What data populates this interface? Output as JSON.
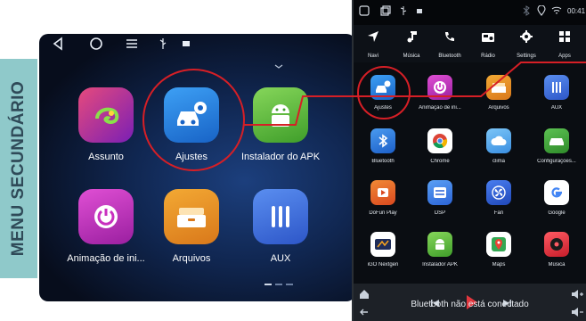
{
  "banner": {
    "text": "MENU SECUNDÁRIO"
  },
  "left_screen": {
    "status_icons": [
      "back-icon",
      "home-icon",
      "menu-icon",
      "usb-icon",
      "image-icon"
    ],
    "apps": [
      {
        "label": "Assunto",
        "icon": "chameleon-icon",
        "color": "#d0346e"
      },
      {
        "label": "Ajustes",
        "icon": "car-gear-icon",
        "color": "#2a8ae6"
      },
      {
        "label": "Instalador do APK",
        "icon": "android-icon",
        "color": "#66c23a"
      },
      {
        "label": "Animação de ini...",
        "icon": "power-icon",
        "color": "#c92fbf"
      },
      {
        "label": "Arquivos",
        "icon": "drawer-icon",
        "color": "#e7951f"
      },
      {
        "label": "AUX",
        "icon": "aux-icon",
        "color": "#3a73e8"
      }
    ]
  },
  "right_screen": {
    "clock": "00:41",
    "nav": [
      {
        "label": "Navi",
        "icon": "navigation-icon"
      },
      {
        "label": "Música",
        "icon": "music-icon"
      },
      {
        "label": "Bluetooth",
        "icon": "phone-icon"
      },
      {
        "label": "Rádio",
        "icon": "radio-icon"
      },
      {
        "label": "Settings",
        "icon": "gear-icon"
      },
      {
        "label": "Apps",
        "icon": "apps-icon"
      }
    ],
    "apps": [
      {
        "label": "Ajustes",
        "icon": "car-gear-icon",
        "color": "#2a8ae6"
      },
      {
        "label": "Animação de ini...",
        "icon": "power-icon",
        "color": "#c92fbf"
      },
      {
        "label": "Arquivos",
        "icon": "drawer-icon",
        "color": "#e7951f"
      },
      {
        "label": "AUX",
        "icon": "aux-icon",
        "color": "#3a73e8"
      },
      {
        "label": "Bluetooth",
        "icon": "bluetooth-icon",
        "color": "#2f7fe0"
      },
      {
        "label": "Chrome",
        "icon": "chrome-icon",
        "color": "#ffffff"
      },
      {
        "label": "clima",
        "icon": "cloud-icon",
        "color": "#4aa6f0"
      },
      {
        "label": "Configurações...",
        "icon": "car-settings-icon",
        "color": "#49a842"
      },
      {
        "label": "DoFun Play",
        "icon": "dofun-icon",
        "color": "#e6602a"
      },
      {
        "label": "DSP",
        "icon": "dsp-icon",
        "color": "#3a79e6"
      },
      {
        "label": "Fan",
        "icon": "fan-icon",
        "color": "#2b64d9"
      },
      {
        "label": "Google",
        "icon": "google-icon",
        "color": "#ffffff"
      },
      {
        "label": "iGO Nextgen",
        "icon": "igo-icon",
        "color": "#ffffff"
      },
      {
        "label": "Instalador APK",
        "icon": "android-icon",
        "color": "#66c23a"
      },
      {
        "label": "Maps",
        "icon": "maps-icon",
        "color": "#ffffff"
      },
      {
        "label": "Música",
        "icon": "music-disc-icon",
        "color": "#e0323c"
      }
    ],
    "bottom_text": "Bluetooth não está conectado"
  }
}
